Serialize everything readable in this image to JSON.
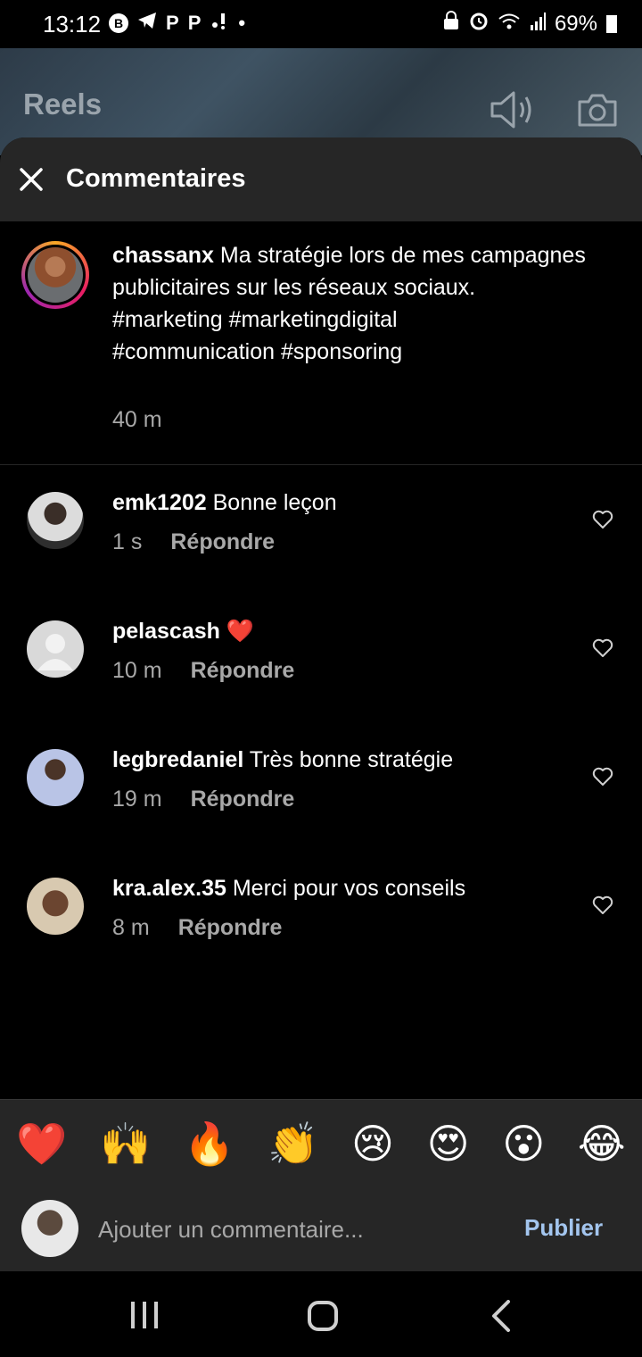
{
  "status_bar": {
    "time": "13:12",
    "left_icons": [
      "B",
      "telegram-icon",
      "P",
      "P",
      "notification-icon",
      "•"
    ],
    "battery": "69%"
  },
  "reels_header": {
    "title": "Reels"
  },
  "sheet": {
    "title": "Commentaires"
  },
  "caption": {
    "username": "chassanx",
    "text": "Ma stratégie lors de mes campagnes publicitaires sur les réseaux sociaux.",
    "hashtags_line1": "#marketing #marketingdigital",
    "hashtags_line2": "#communication #sponsoring",
    "time": "40 m"
  },
  "comments": [
    {
      "username": "emk1202",
      "text": "Bonne leçon",
      "time": "1 s",
      "reply": "Répondre"
    },
    {
      "username": "pelascash",
      "text": "❤️",
      "time": "10 m",
      "reply": "Répondre"
    },
    {
      "username": "legbredaniel",
      "text": "Très bonne stratégie",
      "time": "19 m",
      "reply": "Répondre"
    },
    {
      "username": "kra.alex.35",
      "text": "Merci pour vos conseils",
      "time": "8 m",
      "reply": "Répondre"
    }
  ],
  "emoji_bar": [
    "❤️",
    "🙌",
    "🔥",
    "👏",
    "😢",
    "😍",
    "😮",
    "😂"
  ],
  "input": {
    "placeholder": "Ajouter un commentaire...",
    "publish_label": "Publier"
  },
  "colors": {
    "sheet_header_bg": "#262626",
    "publish_color": "#a3c5ee",
    "muted_text": "#a8a8a8"
  }
}
